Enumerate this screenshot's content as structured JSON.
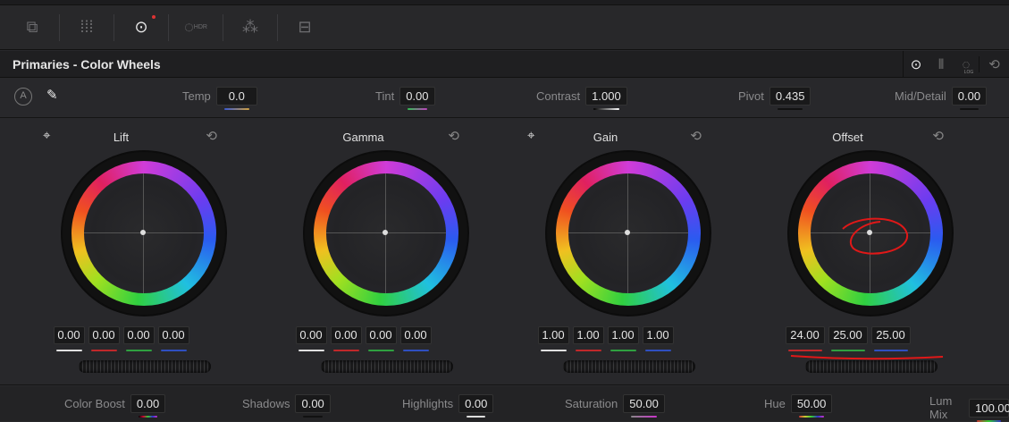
{
  "toolbar": {
    "icons": [
      "camera-raw-icon",
      "color-match-icon",
      "color-wheels-icon",
      "hdr-wheels-icon",
      "rgb-mixer-icon",
      "motion-effects-icon"
    ],
    "hdr_label": "HDR"
  },
  "header": {
    "title": "Primaries - Color Wheels",
    "icons": [
      "wheels-mode-icon",
      "bars-mode-icon",
      "log-mode-icon",
      "reset-all-icon"
    ],
    "log_label": "LOG"
  },
  "controls": {
    "auto_label": "A",
    "temp": {
      "label": "Temp",
      "value": "0.0"
    },
    "tint": {
      "label": "Tint",
      "value": "0.00"
    },
    "contrast": {
      "label": "Contrast",
      "value": "1.000"
    },
    "pivot": {
      "label": "Pivot",
      "value": "0.435"
    },
    "mid_detail": {
      "label": "Mid/Detail",
      "value": "0.00"
    }
  },
  "wheels": [
    {
      "name": "Lift",
      "values": [
        "0.00",
        "0.00",
        "0.00",
        "0.00"
      ]
    },
    {
      "name": "Gamma",
      "values": [
        "0.00",
        "0.00",
        "0.00",
        "0.00"
      ]
    },
    {
      "name": "Gain",
      "values": [
        "1.00",
        "1.00",
        "1.00",
        "1.00"
      ]
    },
    {
      "name": "Offset",
      "values": [
        "24.00",
        "25.00",
        "25.00"
      ]
    }
  ],
  "bottom": {
    "color_boost": {
      "label": "Color Boost",
      "value": "0.00"
    },
    "shadows": {
      "label": "Shadows",
      "value": "0.00"
    },
    "highlights": {
      "label": "Highlights",
      "value": "0.00"
    },
    "saturation": {
      "label": "Saturation",
      "value": "50.00"
    },
    "hue": {
      "label": "Hue",
      "value": "50.00"
    },
    "lum_mix": {
      "label": "Lum Mix",
      "value": "100.00"
    }
  },
  "colors": {
    "red": "#c0282a",
    "green": "#2fa040",
    "blue": "#2f4fc0",
    "white": "#e0e0e0",
    "annotation": "#e01818"
  }
}
